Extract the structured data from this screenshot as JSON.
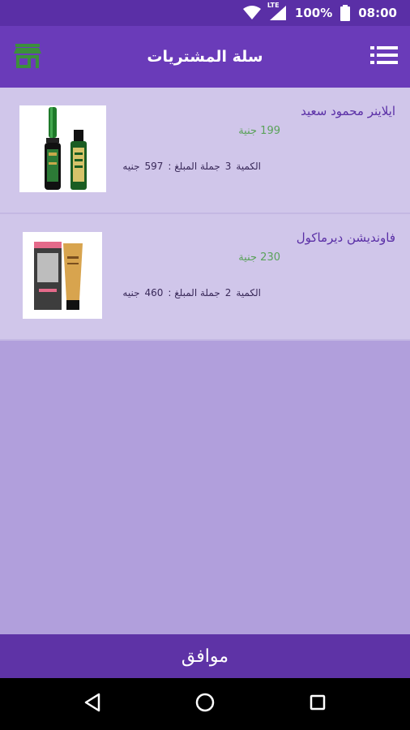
{
  "status_bar": {
    "network": "LTE",
    "battery": "100%",
    "time": "08:00"
  },
  "app_bar": {
    "title": "سلة المشتريات",
    "left_icon": "store-icon",
    "right_icon": "menu-icon"
  },
  "cart": {
    "items": [
      {
        "name": "ايلاينر محمود سعيد",
        "price": "199 جنية",
        "quantity_label": "الكمية",
        "quantity": "3",
        "total_label": "جملة المبلغ :",
        "total_value": "597",
        "total_currency": "جنيه"
      },
      {
        "name": "فاونديشن ديرماكول",
        "price": "230 جنية",
        "quantity_label": "الكمية",
        "quantity": "2",
        "total_label": "جملة المبلغ :",
        "total_value": "460",
        "total_currency": "جنيه"
      }
    ]
  },
  "ok_button": {
    "label": "موافق"
  },
  "colors": {
    "status_bar": "#5a2fa6",
    "app_bar": "#6a3bb9",
    "item_bg": "#d0c6ea",
    "page_bg": "#b19fdc",
    "price_green": "#5aa25a",
    "title_purple": "#5a2fa6",
    "store_icon_green": "#3c8f3c"
  }
}
